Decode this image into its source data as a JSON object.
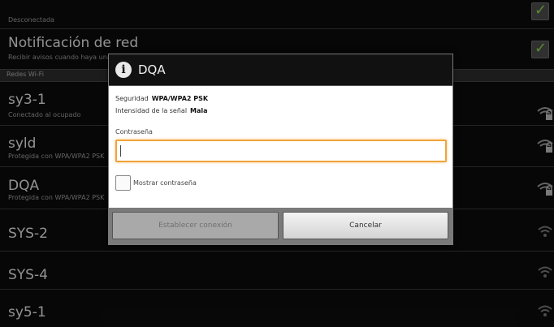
{
  "network_list": {
    "top_item": {
      "title": "",
      "subtitle": "Desconectada"
    },
    "notification": {
      "title": "Notificación de red",
      "subtitle": "Recibir avisos cuando haya una red abierta disponible",
      "checked": true
    },
    "section_header": "Redes Wi-Fi",
    "networks": [
      {
        "name": "sy3-1",
        "status": "Conectado al ocupado"
      },
      {
        "name": "syld",
        "status": "Protegida con WPA/WPA2 PSK"
      },
      {
        "name": "DQA",
        "status": "Protegida con WPA/WPA2 PSK"
      },
      {
        "name": "SYS-2",
        "status": ""
      },
      {
        "name": "SYS-4",
        "status": ""
      },
      {
        "name": "sy5-1",
        "status": ""
      }
    ]
  },
  "dialog": {
    "title": "DQA",
    "icon": "info-icon",
    "security_label": "Seguridad",
    "security_value": "WPA/WPA2 PSK",
    "signal_label": "Intensidad de la señal",
    "signal_value": "Mala",
    "password_label": "Contraseña",
    "password_value": "",
    "password_placeholder": "",
    "show_password_label": "Mostrar contraseña",
    "show_password_checked": false,
    "forget_button": "Establecer conexión",
    "cancel_button": "Cancelar"
  },
  "colors": {
    "accent_focus": "#f0a43c",
    "check_green": "#8bd34a",
    "background": "#0c0c0c"
  }
}
